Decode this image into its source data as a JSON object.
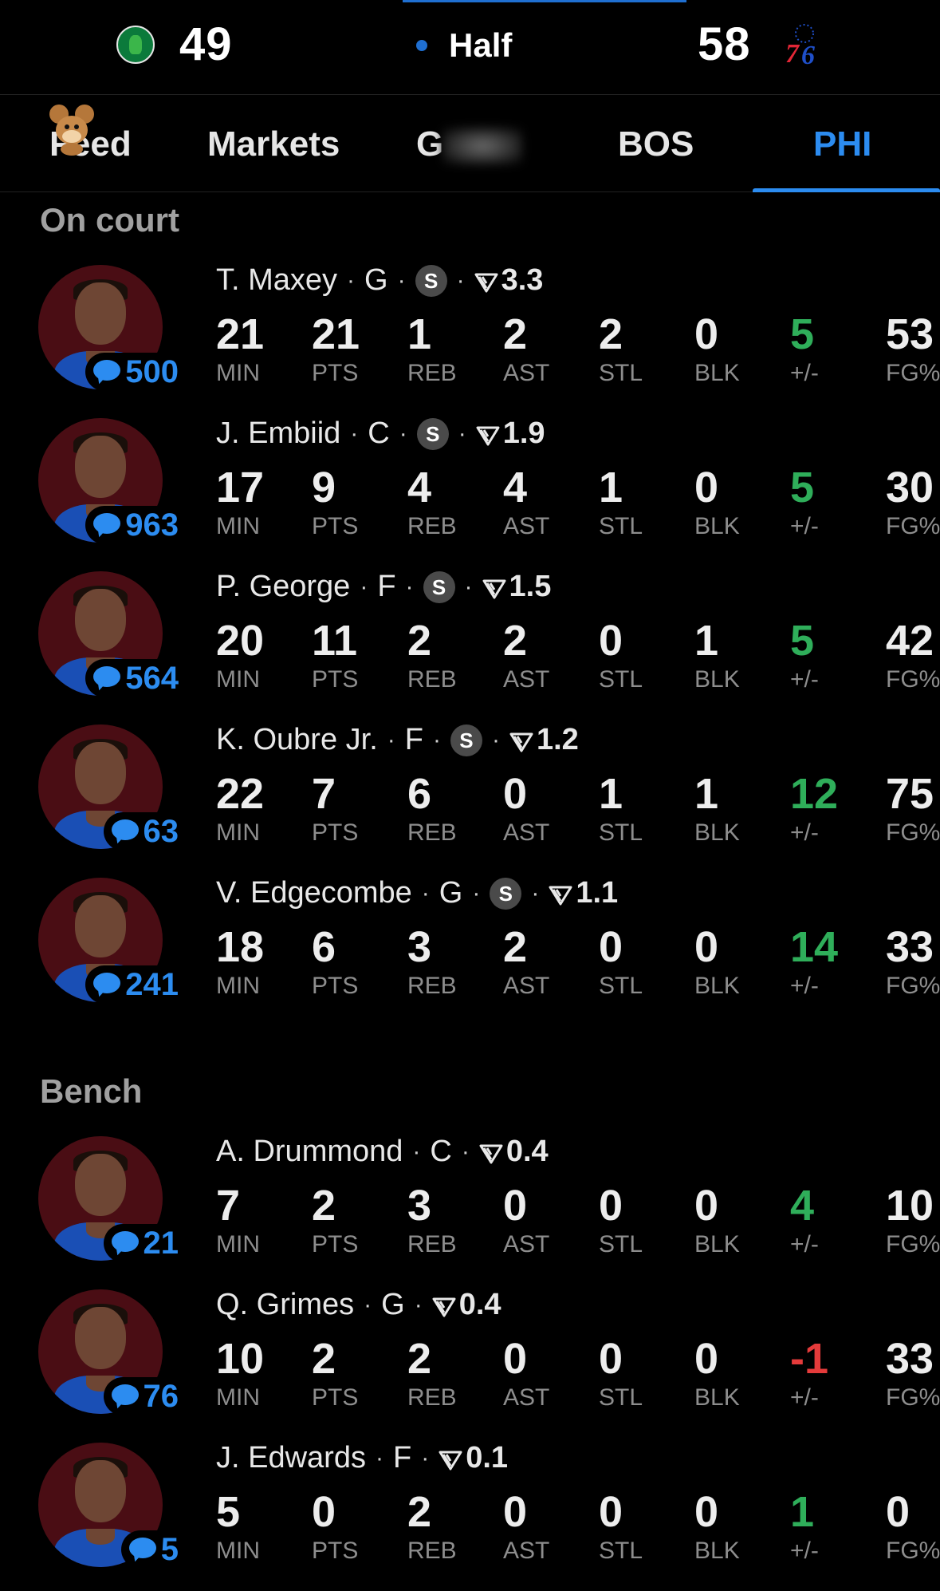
{
  "header": {
    "away": {
      "abbr": "BOS",
      "score": "49"
    },
    "home": {
      "abbr": "PHI",
      "score": "58"
    },
    "status": "Half"
  },
  "tabs": [
    {
      "label": "Feed",
      "active": false
    },
    {
      "label": "Markets",
      "active": false
    },
    {
      "label": "G",
      "active": false
    },
    {
      "label": "BOS",
      "active": false
    },
    {
      "label": "PHI",
      "active": true
    }
  ],
  "sections": {
    "on_court": "On court",
    "bench": "Bench"
  },
  "stat_labels": [
    "MIN",
    "PTS",
    "REB",
    "AST",
    "STL",
    "BLK",
    "+/-",
    "FG%"
  ],
  "starter_badge": "S",
  "players": [
    {
      "name": "T. Maxey",
      "pos": "G",
      "starter": true,
      "rank": "3.3",
      "comments": "500",
      "stats": [
        "21",
        "21",
        "1",
        "2",
        "2",
        "0",
        "5",
        "53"
      ],
      "pm_sign": "pos"
    },
    {
      "name": "J. Embiid",
      "pos": "C",
      "starter": true,
      "rank": "1.9",
      "comments": "963",
      "stats": [
        "17",
        "9",
        "4",
        "4",
        "1",
        "0",
        "5",
        "30"
      ],
      "pm_sign": "pos"
    },
    {
      "name": "P. George",
      "pos": "F",
      "starter": true,
      "rank": "1.5",
      "comments": "564",
      "stats": [
        "20",
        "11",
        "2",
        "2",
        "0",
        "1",
        "5",
        "42"
      ],
      "pm_sign": "pos"
    },
    {
      "name": "K. Oubre Jr.",
      "pos": "F",
      "starter": true,
      "rank": "1.2",
      "comments": "63",
      "stats": [
        "22",
        "7",
        "6",
        "0",
        "1",
        "1",
        "12",
        "75"
      ],
      "pm_sign": "pos"
    },
    {
      "name": "V. Edgecombe",
      "pos": "G",
      "starter": true,
      "rank": "1.1",
      "comments": "241",
      "stats": [
        "18",
        "6",
        "3",
        "2",
        "0",
        "0",
        "14",
        "33"
      ],
      "pm_sign": "pos"
    },
    {
      "name": "A. Drummond",
      "pos": "C",
      "starter": false,
      "rank": "0.4",
      "comments": "21",
      "stats": [
        "7",
        "2",
        "3",
        "0",
        "0",
        "0",
        "4",
        "10"
      ],
      "pm_sign": "pos"
    },
    {
      "name": "Q. Grimes",
      "pos": "G",
      "starter": false,
      "rank": "0.4",
      "comments": "76",
      "stats": [
        "10",
        "2",
        "2",
        "0",
        "0",
        "0",
        "-1",
        "33"
      ],
      "pm_sign": "neg"
    },
    {
      "name": "J. Edwards",
      "pos": "F",
      "starter": false,
      "rank": "0.1",
      "comments": "5",
      "stats": [
        "5",
        "0",
        "2",
        "0",
        "0",
        "0",
        "1",
        "0"
      ],
      "pm_sign": "pos"
    }
  ],
  "colors": {
    "accent": "#2c8cf0",
    "positive": "#2fae5a",
    "negative": "#e53b3b",
    "avatar_bg": "#4a0d14"
  }
}
